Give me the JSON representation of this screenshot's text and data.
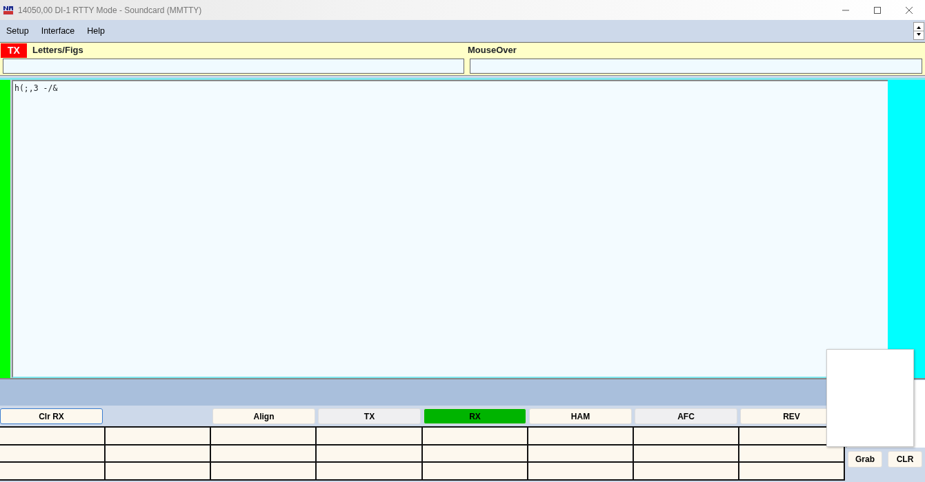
{
  "window": {
    "title": "14050,00  DI-1 RTTY Mode - Soundcard (MMTTY)"
  },
  "menu": [
    "Setup",
    "Interface",
    "Help"
  ],
  "status": {
    "tx_badge": "TX",
    "mode_label": "Letters/Figs",
    "mouseover_label": "MouseOver"
  },
  "receive_text": "h(;,3 -/&",
  "buttons": [
    {
      "label": "Clr RX",
      "kind": "plain",
      "focused": true
    },
    {
      "label": "Align",
      "kind": "plain",
      "focused": false
    },
    {
      "label": "TX",
      "kind": "grey",
      "focused": false
    },
    {
      "label": "RX",
      "kind": "active",
      "focused": false
    },
    {
      "label": "HAM",
      "kind": "plain",
      "focused": false
    },
    {
      "label": "AFC",
      "kind": "grey",
      "focused": false
    },
    {
      "label": "REV",
      "kind": "plain",
      "focused": false
    }
  ],
  "side_buttons": [
    "Grab",
    "CLR"
  ]
}
